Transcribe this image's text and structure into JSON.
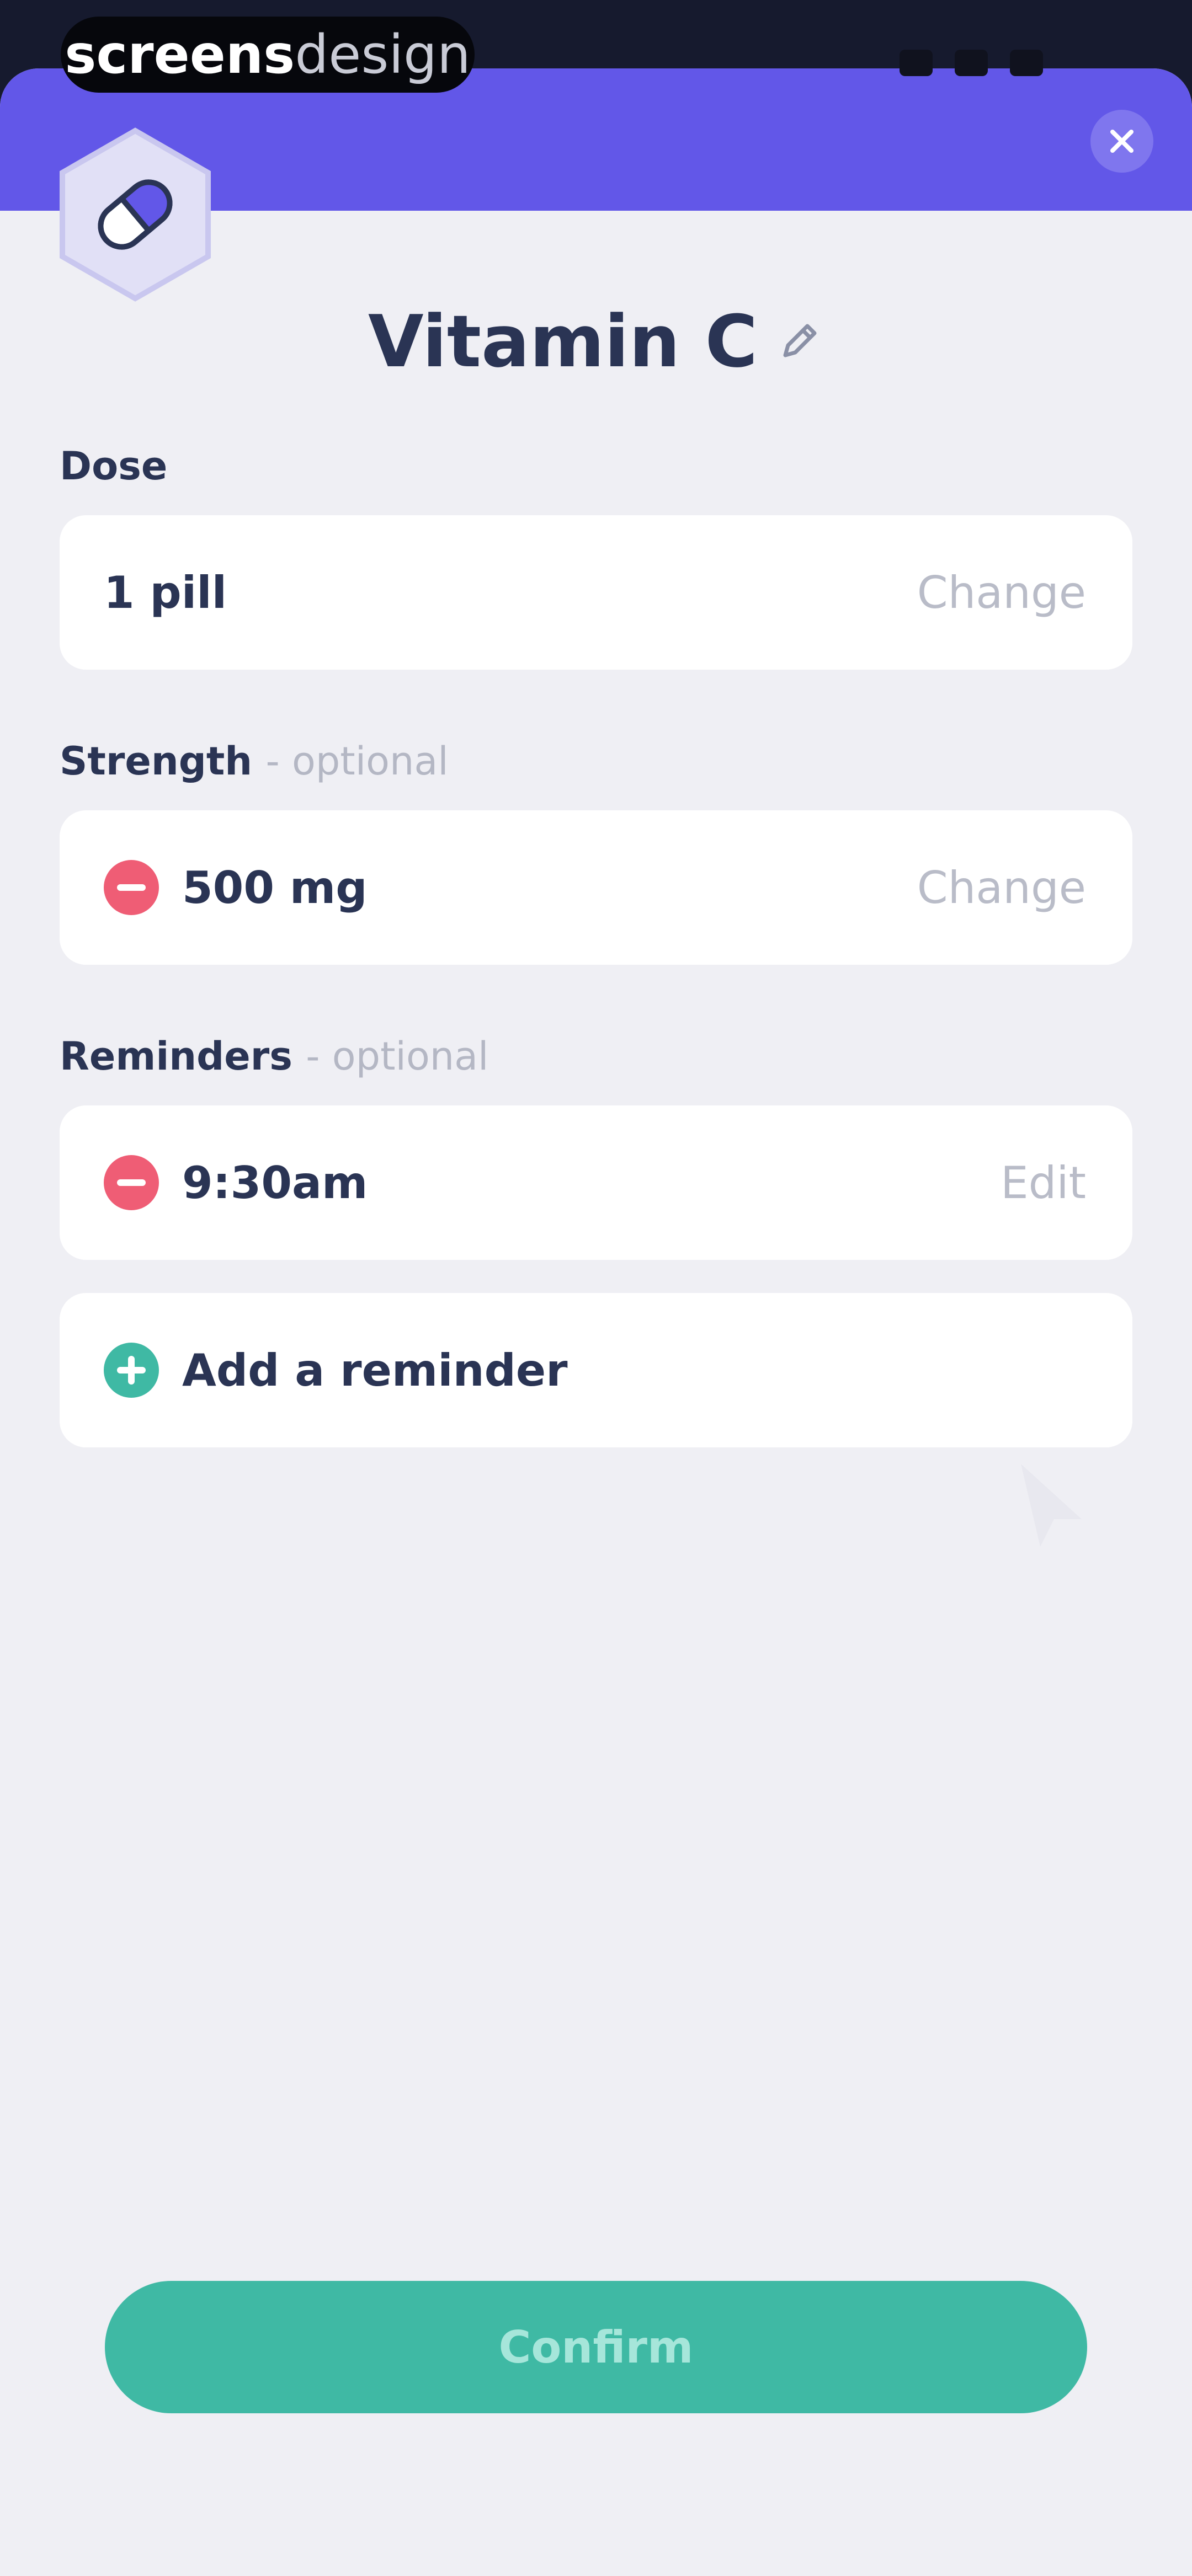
{
  "watermark": {
    "part_bold": "screens",
    "part_light": "design"
  },
  "medication": {
    "name": "Vitamin C",
    "icon": "pill-icon"
  },
  "sections": {
    "dose": {
      "label": "Dose",
      "value": "1 pill",
      "action": "Change"
    },
    "strength": {
      "label": "Strength",
      "optional_note": "- optional",
      "value": "500 mg",
      "action": "Change",
      "icon": "minus-circle-icon"
    },
    "reminders": {
      "label": "Reminders",
      "optional_note": "- optional",
      "items": [
        {
          "time": "9:30am",
          "action": "Edit",
          "icon": "minus-circle-icon"
        }
      ],
      "add_label": "Add a reminder",
      "add_icon": "plus-circle-icon"
    }
  },
  "confirm_label": "Confirm",
  "colors": {
    "header": "#6257e8",
    "background": "#efeff4",
    "title_text": "#2a3454",
    "remove_red": "#ef5d75",
    "add_teal": "#3fb9a4",
    "confirm_button": "#3fb9a4"
  }
}
